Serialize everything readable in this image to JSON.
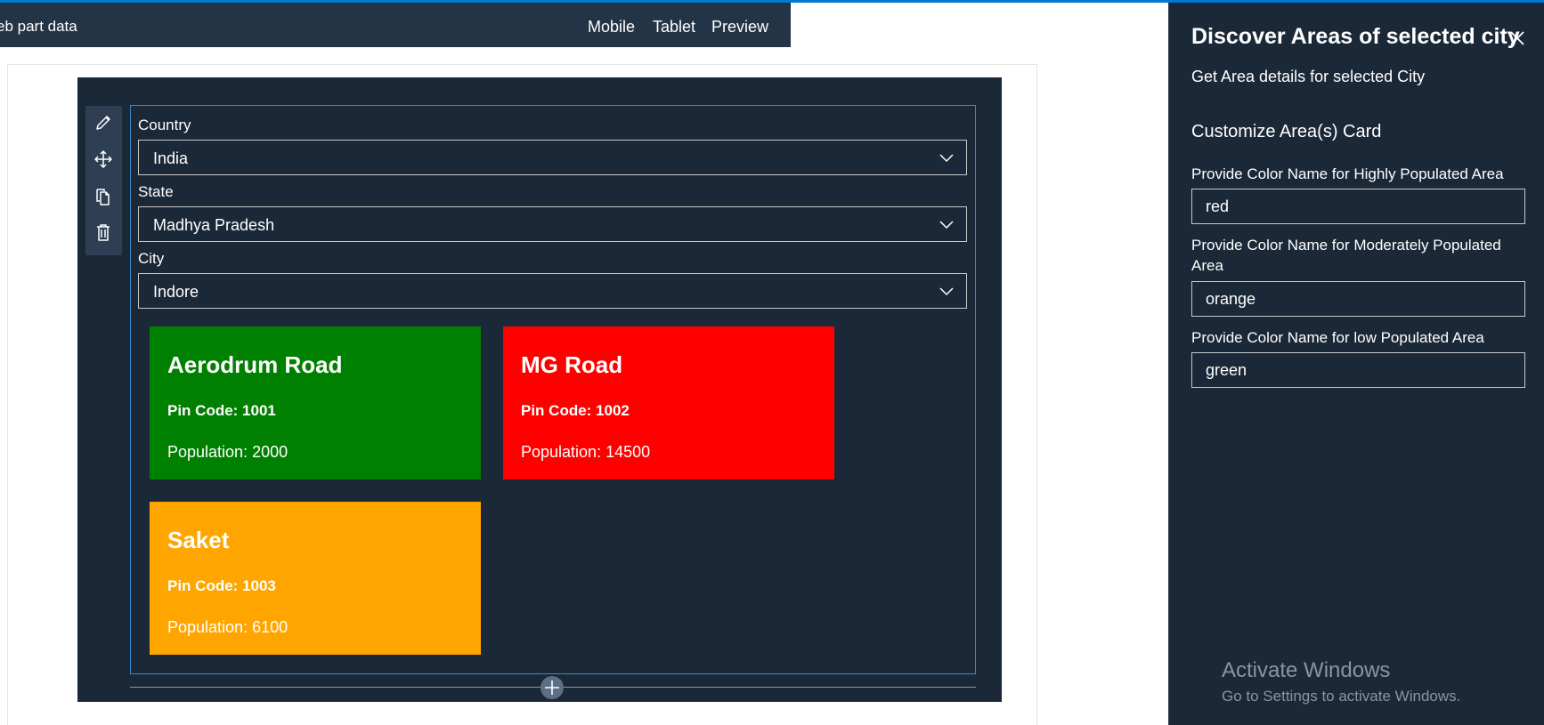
{
  "toolbar": {
    "title": "eb part data",
    "buttons": [
      "Mobile",
      "Tablet",
      "Preview"
    ]
  },
  "side_toolbar": {
    "icons": [
      "edit-icon",
      "move-icon",
      "copy-icon",
      "delete-icon"
    ]
  },
  "webpart": {
    "country_label": "Country",
    "country_value": "India",
    "state_label": "State",
    "state_value": "Madhya Pradesh",
    "city_label": "City",
    "city_value": "Indore",
    "cards": [
      {
        "name": "Aerodrum Road",
        "pin": "Pin Code: 1001",
        "population": "Population: 2000",
        "color": "#008000"
      },
      {
        "name": "MG Road",
        "pin": "Pin Code: 1002",
        "population": "Population: 14500",
        "color": "#ff0000"
      },
      {
        "name": "Saket",
        "pin": "Pin Code: 1003",
        "population": "Population: 6100",
        "color": "#ffa500"
      }
    ]
  },
  "pane": {
    "title": "Discover Areas of selected city",
    "description": "Get Area details for selected City",
    "group_title": "Customize Area(s) Card",
    "fields": [
      {
        "label": "Provide Color Name for Highly Populated Area",
        "value": "red"
      },
      {
        "label": "Provide Color Name for Moderately Populated Area",
        "value": "orange"
      },
      {
        "label": "Provide Color Name for low Populated Area",
        "value": "green"
      }
    ]
  },
  "watermark": {
    "title": "Activate Windows",
    "subtitle": "Go to Settings to activate Windows."
  },
  "colors": {
    "accent": "#0078d4",
    "toolbar_bg": "#243447",
    "section_bg": "#1b2838",
    "pane_bg": "#1b2838"
  }
}
